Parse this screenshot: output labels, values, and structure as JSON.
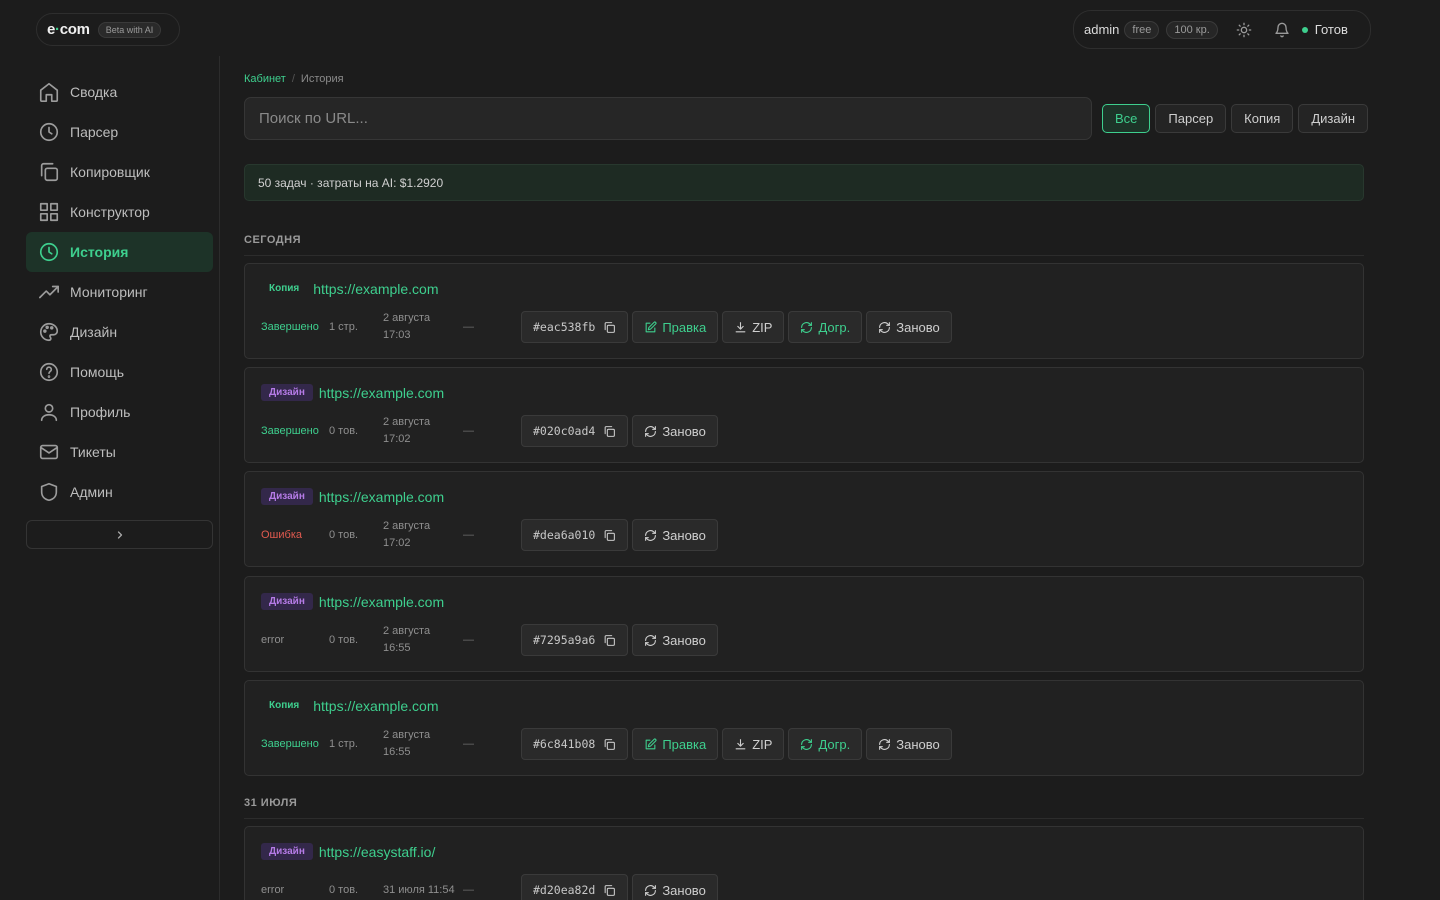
{
  "header": {
    "logo_e": "e",
    "logo_dot": "·",
    "logo_com": "com",
    "beta_label": "Beta with AI",
    "user_name": "admin",
    "plan": "free",
    "credits": "100 кр.",
    "status_label": "Готов"
  },
  "sidebar": {
    "items": [
      {
        "label": "Сводка",
        "icon": "home-icon"
      },
      {
        "label": "Парсер",
        "icon": "clock-icon"
      },
      {
        "label": "Копировщик",
        "icon": "copy-icon"
      },
      {
        "label": "Конструктор",
        "icon": "grid-icon"
      },
      {
        "label": "История",
        "icon": "history-icon",
        "active": true
      },
      {
        "label": "Мониторинг",
        "icon": "trending-icon"
      },
      {
        "label": "Дизайн",
        "icon": "palette-icon"
      },
      {
        "label": "Помощь",
        "icon": "help-icon"
      },
      {
        "label": "Профиль",
        "icon": "user-icon"
      },
      {
        "label": "Тикеты",
        "icon": "mail-icon"
      },
      {
        "label": "Админ",
        "icon": "shield-icon"
      }
    ],
    "collapse_label": "›"
  },
  "breadcrumb": {
    "parent": "Кабинет",
    "separator": "/",
    "current": "История"
  },
  "search": {
    "placeholder": "Поиск по URL..."
  },
  "filters": [
    "Все",
    "Парсер",
    "Копия",
    "Дизайн"
  ],
  "summary": "50 задач · затраты на AI: $1.2920",
  "sections": [
    {
      "title": "СЕГОДНЯ",
      "tasks": [
        {
          "type": "copy",
          "badge": "Копия",
          "url": "https://example.com",
          "status": "Завершено",
          "status_kind": "ok",
          "count": "1 стр.",
          "date1": "2 августа",
          "date2": "17:03",
          "dash": "—",
          "hash": "#eac538fb",
          "full": true
        },
        {
          "type": "design",
          "badge": "Дизайн",
          "url": "https://example.com",
          "status": "Завершено",
          "status_kind": "ok",
          "count": "0 тов.",
          "date1": "2 августа",
          "date2": "17:02",
          "dash": "—",
          "hash": "#020c0ad4",
          "full": false
        },
        {
          "type": "design",
          "badge": "Дизайн",
          "url": "https://example.com",
          "status": "Ошибка",
          "status_kind": "err",
          "count": "0 тов.",
          "date1": "2 августа",
          "date2": "17:02",
          "dash": "—",
          "hash": "#dea6a010",
          "full": false
        },
        {
          "type": "design",
          "badge": "Дизайн",
          "url": "https://example.com",
          "status": "error",
          "status_kind": "plain",
          "count": "0 тов.",
          "date1": "2 августа",
          "date2": "16:55",
          "dash": "—",
          "hash": "#7295a9a6",
          "full": false
        },
        {
          "type": "copy",
          "badge": "Копия",
          "url": "https://example.com",
          "status": "Завершено",
          "status_kind": "ok",
          "count": "1 стр.",
          "date1": "2 августа",
          "date2": "16:55",
          "dash": "—",
          "hash": "#6c841b08",
          "full": true
        }
      ]
    },
    {
      "title": "31 ИЮЛЯ",
      "tasks": [
        {
          "type": "design",
          "badge": "Дизайн",
          "url": "https://easystaff.io/",
          "status": "error",
          "status_kind": "plain",
          "count": "0 тов.",
          "date1": "31 июля 11:54",
          "date2": "",
          "dash": "—",
          "hash": "#d20ea82d",
          "full": false
        }
      ]
    }
  ],
  "actions": {
    "edit": "Правка",
    "zip": "ZIP",
    "continue": "Догр.",
    "retry": "Заново"
  },
  "colors": {
    "accent": "#3ecf8e",
    "error": "#e05a4f",
    "design_badge": "#b57be6",
    "background": "#1c1c1c"
  }
}
